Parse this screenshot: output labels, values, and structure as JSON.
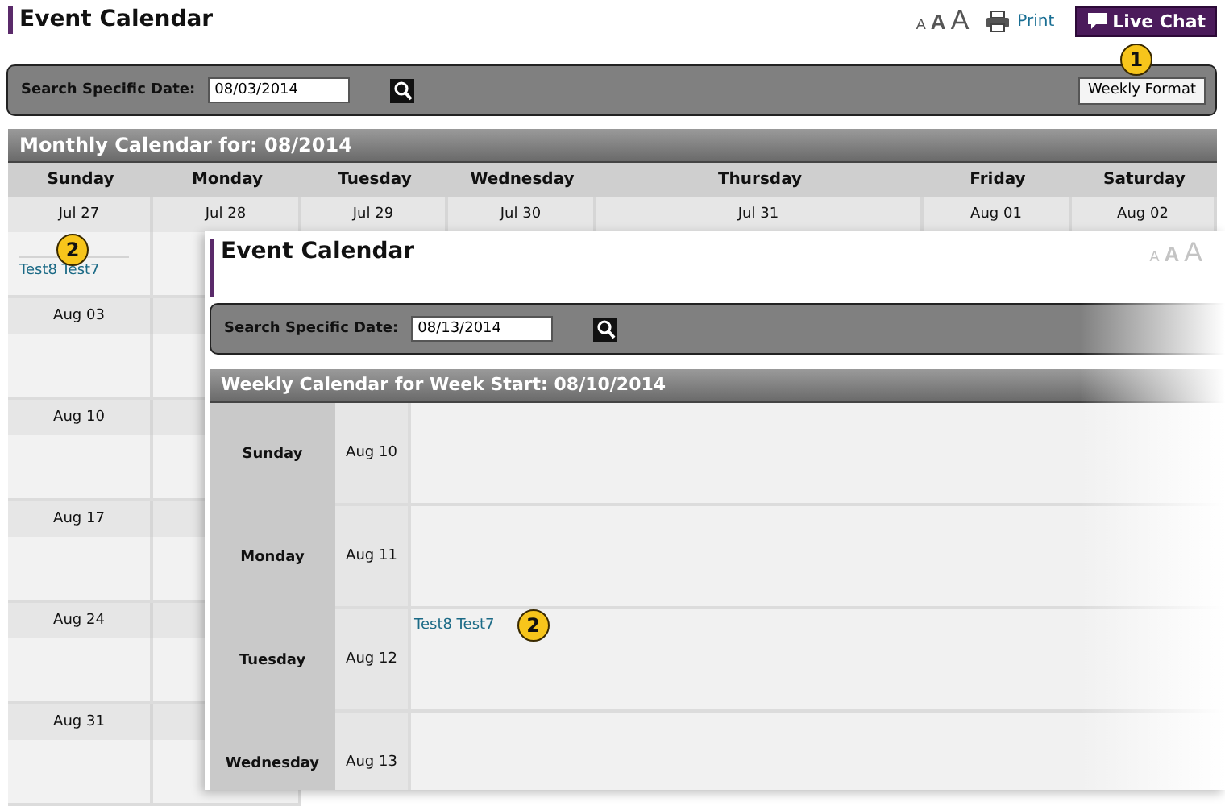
{
  "header": {
    "title": "Event Calendar",
    "font_sizes": [
      "A",
      "A",
      "A"
    ],
    "print_link": "Print",
    "chat_button": "Live Chat"
  },
  "search_bar": {
    "label": "Search Specific Date:",
    "value": "08/03/2014",
    "format_button": {
      "label": "Weekly Format",
      "callout": "1"
    }
  },
  "monthly_calendar": {
    "title": "Monthly Calendar for: 08/2014",
    "columns": [
      "Sunday",
      "Monday",
      "Tuesday",
      "Wednesday",
      "Thursday",
      "Friday",
      "Saturday"
    ],
    "weeks": [
      {
        "days": [
          {
            "date": "Jul 27",
            "events": [
              {
                "title": "Test8 Test7",
                "callout": "2"
              }
            ]
          },
          {
            "date": "Jul 28"
          },
          {
            "date": "Jul 29"
          },
          {
            "date": "Jul 30"
          },
          {
            "date": "Jul 31"
          },
          {
            "date": "Aug 01"
          },
          {
            "date": "Aug 02"
          }
        ]
      },
      {
        "days": [
          {
            "date": "Aug 03"
          }
        ]
      },
      {
        "days": [
          {
            "date": "Aug 10"
          }
        ]
      },
      {
        "days": [
          {
            "date": "Aug 17"
          }
        ]
      },
      {
        "days": [
          {
            "date": "Aug 24"
          }
        ]
      },
      {
        "days": [
          {
            "date": "Aug 31"
          }
        ]
      }
    ]
  },
  "overlay": {
    "title": "Event Calendar",
    "font_sizes": [
      "A",
      "A",
      "A"
    ],
    "search_bar": {
      "label": "Search Specific Date:",
      "value": "08/13/2014"
    },
    "weekly_calendar": {
      "title": "Weekly Calendar for Week Start: 08/10/2014",
      "days": [
        {
          "day": "Sunday",
          "date": "Aug 10"
        },
        {
          "day": "Monday",
          "date": "Aug 11"
        },
        {
          "day": "Tuesday",
          "date": "Aug 12",
          "events": [
            {
              "title": "Test8 Test7",
              "callout": "2"
            }
          ]
        },
        {
          "day": "Wednesday",
          "date": "Aug 13"
        }
      ]
    }
  }
}
